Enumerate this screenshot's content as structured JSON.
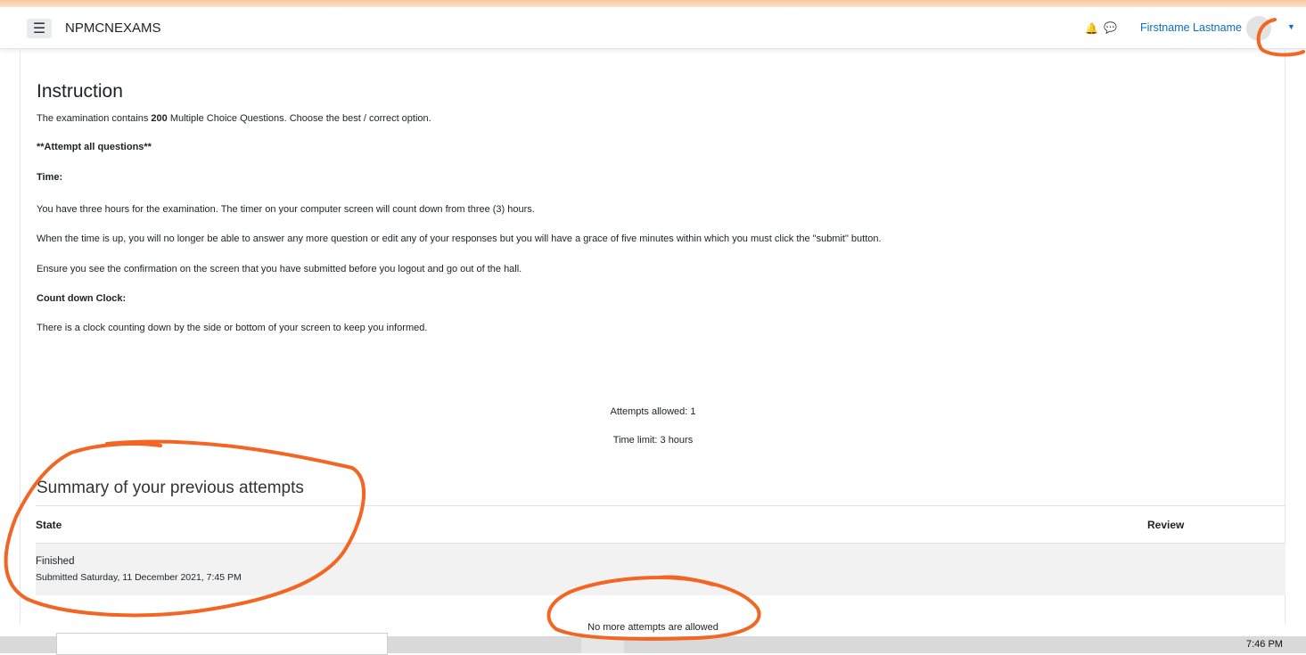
{
  "navbar": {
    "site_name": "NPMCNEXAMS",
    "menu_icon": "hamburger-icon",
    "notification_icon": "bell-icon",
    "messages_icon": "chat-bubble-icon",
    "user_name": "Firstname Lastname",
    "dropdown_icon": "caret-down-icon"
  },
  "instruction": {
    "heading": "Instruction",
    "intro_pre": "The examination contains ",
    "intro_count": "200",
    "intro_post": " Multiple Choice Questions. Choose the best / correct option.",
    "attempt_all": "**Attempt all questions**",
    "time_heading": "Time:",
    "time_p1": "You have three hours for the examination. The timer on your computer screen will count down from three (3) hours.",
    "time_p2": "When the time is up, you will no longer be able to answer any more question or edit any of your responses but you will have a grace of five minutes within which you must click the \"submit\" button.",
    "time_p3": "Ensure you see the confirmation on the screen that you have submitted before you logout and go out of the hall.",
    "clock_heading": "Count down Clock:",
    "clock_p": "There is a clock counting down by the side or bottom of your screen to keep you informed."
  },
  "quiz_info": {
    "attempts_allowed": "Attempts allowed: 1",
    "time_limit": "Time limit: 3 hours"
  },
  "summary": {
    "heading": "Summary of your previous attempts",
    "columns": [
      "State",
      "Review"
    ],
    "rows": [
      {
        "state": "Finished",
        "submitted": "Submitted Saturday, 11 December 2021, 7:45 PM",
        "review": ""
      }
    ],
    "no_more_attempts": "No more attempts are allowed"
  },
  "taskbar": {
    "time": "7:46 PM"
  },
  "colors": {
    "accent": "#0f6cbf",
    "annotation": "#f26522",
    "row_bg": "#f2f2f2",
    "top_band": "#f7c89a"
  }
}
